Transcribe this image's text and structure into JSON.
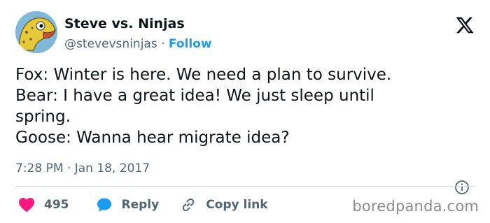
{
  "author": {
    "display_name": "Steve vs. Ninjas",
    "handle": "@stevevsninjas",
    "separator": " · ",
    "follow_label": "Follow",
    "avatar": "fish-cartoon-avatar"
  },
  "platform_icon": "x-logo-icon",
  "tweet": {
    "lines": [
      "Fox: Winter is here. We need a plan to survive.",
      "Bear: I have a great idea! We just sleep until",
      "spring.",
      "Goose: Wanna hear migrate idea?"
    ]
  },
  "meta": {
    "timestamp": "7:28 PM · Jan 18, 2017",
    "info_icon": "info-circle-icon"
  },
  "actions": {
    "like_count": "495",
    "reply_label": "Reply",
    "copy_link_label": "Copy link"
  },
  "colors": {
    "accent": "#1d9bf0",
    "like": "#f91880",
    "text_secondary": "#536471"
  },
  "watermark": "boredpanda.com"
}
